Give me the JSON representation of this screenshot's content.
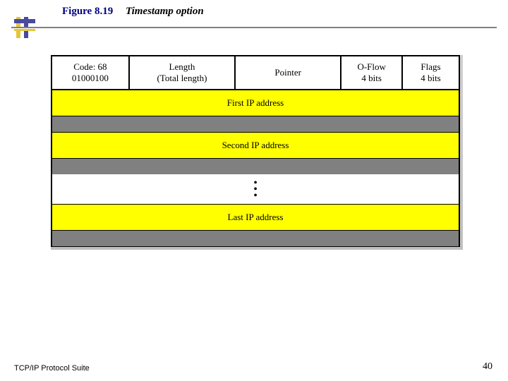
{
  "figure_number": "Figure 8.19",
  "figure_caption": "Timestamp option",
  "header": {
    "code": {
      "line1": "Code: 68",
      "line2": "01000100"
    },
    "length": {
      "line1": "Length",
      "line2": "(Total length)"
    },
    "pointer": "Pointer",
    "oflow": {
      "line1": "O-Flow",
      "line2": "4 bits"
    },
    "flags": {
      "line1": "Flags",
      "line2": "4 bits"
    }
  },
  "rows": {
    "first_ip": "First IP address",
    "second_ip": "Second IP address",
    "last_ip": "Last IP address"
  },
  "footer_left": "TCP/IP Protocol Suite",
  "page_number": "40"
}
